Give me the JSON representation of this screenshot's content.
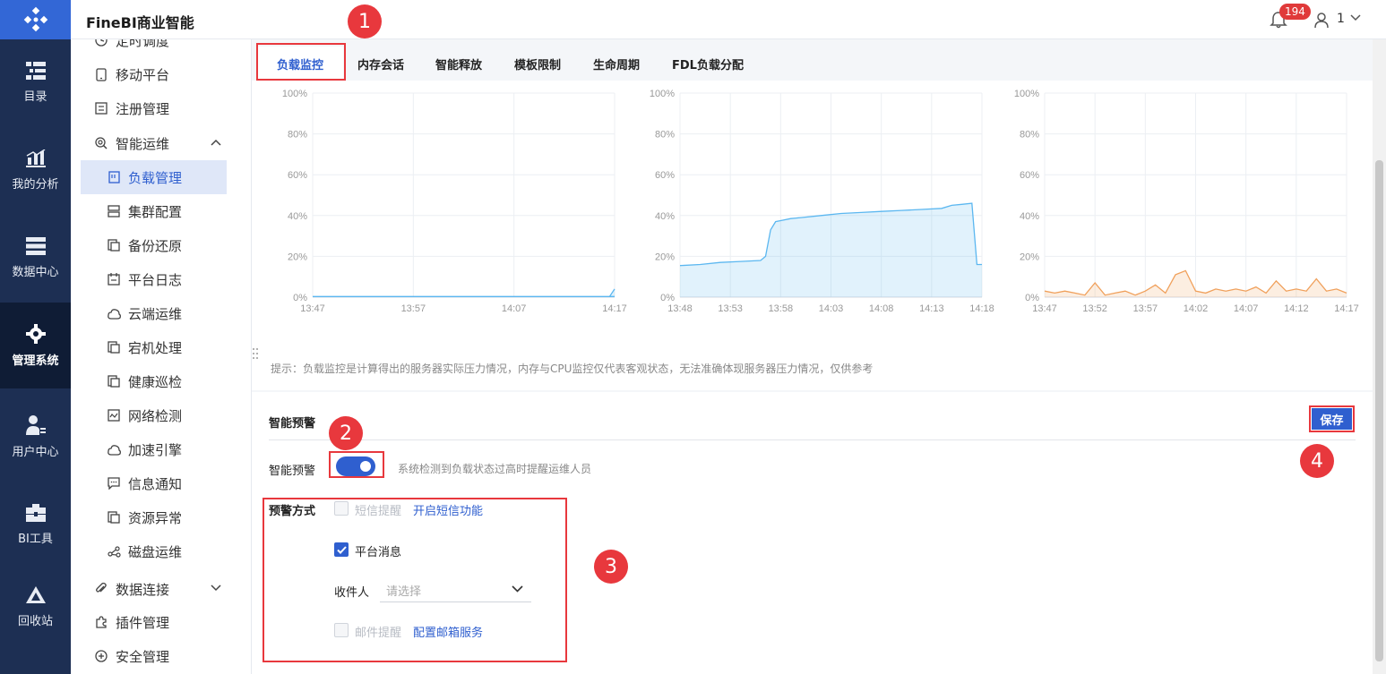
{
  "app": {
    "title": "FineBI商业智能"
  },
  "header": {
    "notification_count": "194",
    "user": "1"
  },
  "rail": [
    {
      "label": "目录",
      "icon": "catalog-icon"
    },
    {
      "label": "我的分析",
      "icon": "analysis-icon"
    },
    {
      "label": "数据中心",
      "icon": "database-icon"
    },
    {
      "label": "管理系统",
      "icon": "gear-icon",
      "active": true
    },
    {
      "label": "用户中心",
      "icon": "user-center-icon"
    },
    {
      "label": "BI工具",
      "icon": "toolbox-icon"
    },
    {
      "label": "回收站",
      "icon": "recycle-icon"
    }
  ],
  "sidebar": {
    "items": [
      {
        "label": "定时调度",
        "icon": "clock-icon",
        "level": 1
      },
      {
        "label": "移动平台",
        "icon": "mobile-icon",
        "level": 1
      },
      {
        "label": "注册管理",
        "icon": "register-icon",
        "level": 1
      },
      {
        "label": "智能运维",
        "icon": "ops-icon",
        "level": 1,
        "expanded": true
      },
      {
        "label": "负载管理",
        "icon": "load-icon",
        "level": 2,
        "active": true
      },
      {
        "label": "集群配置",
        "icon": "cluster-icon",
        "level": 2
      },
      {
        "label": "备份还原",
        "icon": "backup-icon",
        "level": 2
      },
      {
        "label": "平台日志",
        "icon": "log-icon",
        "level": 2
      },
      {
        "label": "云端运维",
        "icon": "cloud-icon",
        "level": 2
      },
      {
        "label": "宕机处理",
        "icon": "crash-icon",
        "level": 2
      },
      {
        "label": "健康巡检",
        "icon": "health-icon",
        "level": 2
      },
      {
        "label": "网络检测",
        "icon": "network-icon",
        "level": 2
      },
      {
        "label": "加速引擎",
        "icon": "engine-icon",
        "level": 2
      },
      {
        "label": "信息通知",
        "icon": "message-icon",
        "level": 2
      },
      {
        "label": "资源异常",
        "icon": "resource-icon",
        "level": 2
      },
      {
        "label": "磁盘运维",
        "icon": "disk-icon",
        "level": 2
      },
      {
        "label": "数据连接",
        "icon": "link-icon",
        "level": 1,
        "expanded": false
      },
      {
        "label": "插件管理",
        "icon": "plugin-icon",
        "level": 1
      },
      {
        "label": "安全管理",
        "icon": "shield-icon",
        "level": 1
      }
    ]
  },
  "tabs": [
    {
      "label": "负载监控",
      "active": true
    },
    {
      "label": "内存会话"
    },
    {
      "label": "智能释放"
    },
    {
      "label": "模板限制"
    },
    {
      "label": "生命周期"
    },
    {
      "label": "FDL负载分配"
    }
  ],
  "chart_data": [
    {
      "type": "area",
      "color": "#5bb7f0",
      "ylim": [
        0,
        100
      ],
      "y_ticks": [
        "100%",
        "80%",
        "60%",
        "40%",
        "20%",
        "0%"
      ],
      "x_ticks": [
        "13:47",
        "13:57",
        "14:07",
        "14:17"
      ],
      "x": [
        0,
        30,
        29.5,
        30
      ],
      "y": [
        0.3,
        0.3,
        0.3,
        4
      ]
    },
    {
      "type": "area",
      "color": "#5bb7f0",
      "ylim": [
        0,
        100
      ],
      "y_ticks": [
        "100%",
        "80%",
        "60%",
        "40%",
        "20%",
        "0%"
      ],
      "x_ticks": [
        "13:48",
        "13:53",
        "13:58",
        "14:03",
        "14:08",
        "14:13",
        "14:18"
      ],
      "x": [
        0,
        2,
        4,
        6,
        8,
        8.5,
        9,
        9.5,
        10,
        11,
        12,
        14,
        16,
        18,
        20,
        22,
        24,
        26,
        27,
        28,
        29,
        29.5,
        30
      ],
      "y": [
        15.5,
        16,
        17,
        17.5,
        18,
        20,
        33,
        37,
        37.5,
        38.5,
        39,
        40,
        41,
        41.5,
        42,
        42.5,
        43,
        43.5,
        45,
        45.5,
        46,
        16,
        16
      ]
    },
    {
      "type": "area",
      "color": "#f0a05b",
      "ylim": [
        0,
        100
      ],
      "y_ticks": [
        "100%",
        "80%",
        "60%",
        "40%",
        "20%",
        "0%"
      ],
      "x_ticks": [
        "13:47",
        "13:52",
        "13:57",
        "14:02",
        "14:07",
        "14:12",
        "14:17"
      ],
      "x": [
        0,
        1,
        2,
        3,
        4,
        5,
        6,
        7,
        8,
        9,
        10,
        11,
        12,
        13,
        14,
        15,
        16,
        17,
        18,
        19,
        20,
        21,
        22,
        23,
        24,
        25,
        26,
        27,
        28,
        29,
        30
      ],
      "y": [
        3,
        2,
        3,
        2,
        1,
        7,
        1,
        2,
        3,
        1,
        3,
        6,
        2,
        11,
        13,
        3,
        2,
        4,
        3,
        4,
        3,
        5,
        2,
        8,
        3,
        4,
        3,
        9,
        3,
        4,
        2
      ]
    }
  ],
  "tip": "提示：负载监控是计算得出的服务器实际压力情况，内存与CPU监控仅代表客观状态，无法准确体现服务器压力情况，仅供参考",
  "alert": {
    "title": "智能预警",
    "save": "保存",
    "toggle_label": "智能预警",
    "toggle_on": true,
    "toggle_desc": "系统检测到负载状态过高时提醒运维人员",
    "method_label": "预警方式",
    "sms_label": "短信提醒",
    "sms_link": "开启短信功能",
    "platform_label": "平台消息",
    "platform_checked": true,
    "recipient_label": "收件人",
    "recipient_placeholder": "请选择",
    "email_label": "邮件提醒",
    "email_link": "配置邮箱服务"
  },
  "callouts": [
    "1",
    "2",
    "3",
    "4"
  ],
  "colors": {
    "accent": "#2f5fcf",
    "rail": "#1d2f53",
    "highlight": "#e8383d"
  }
}
